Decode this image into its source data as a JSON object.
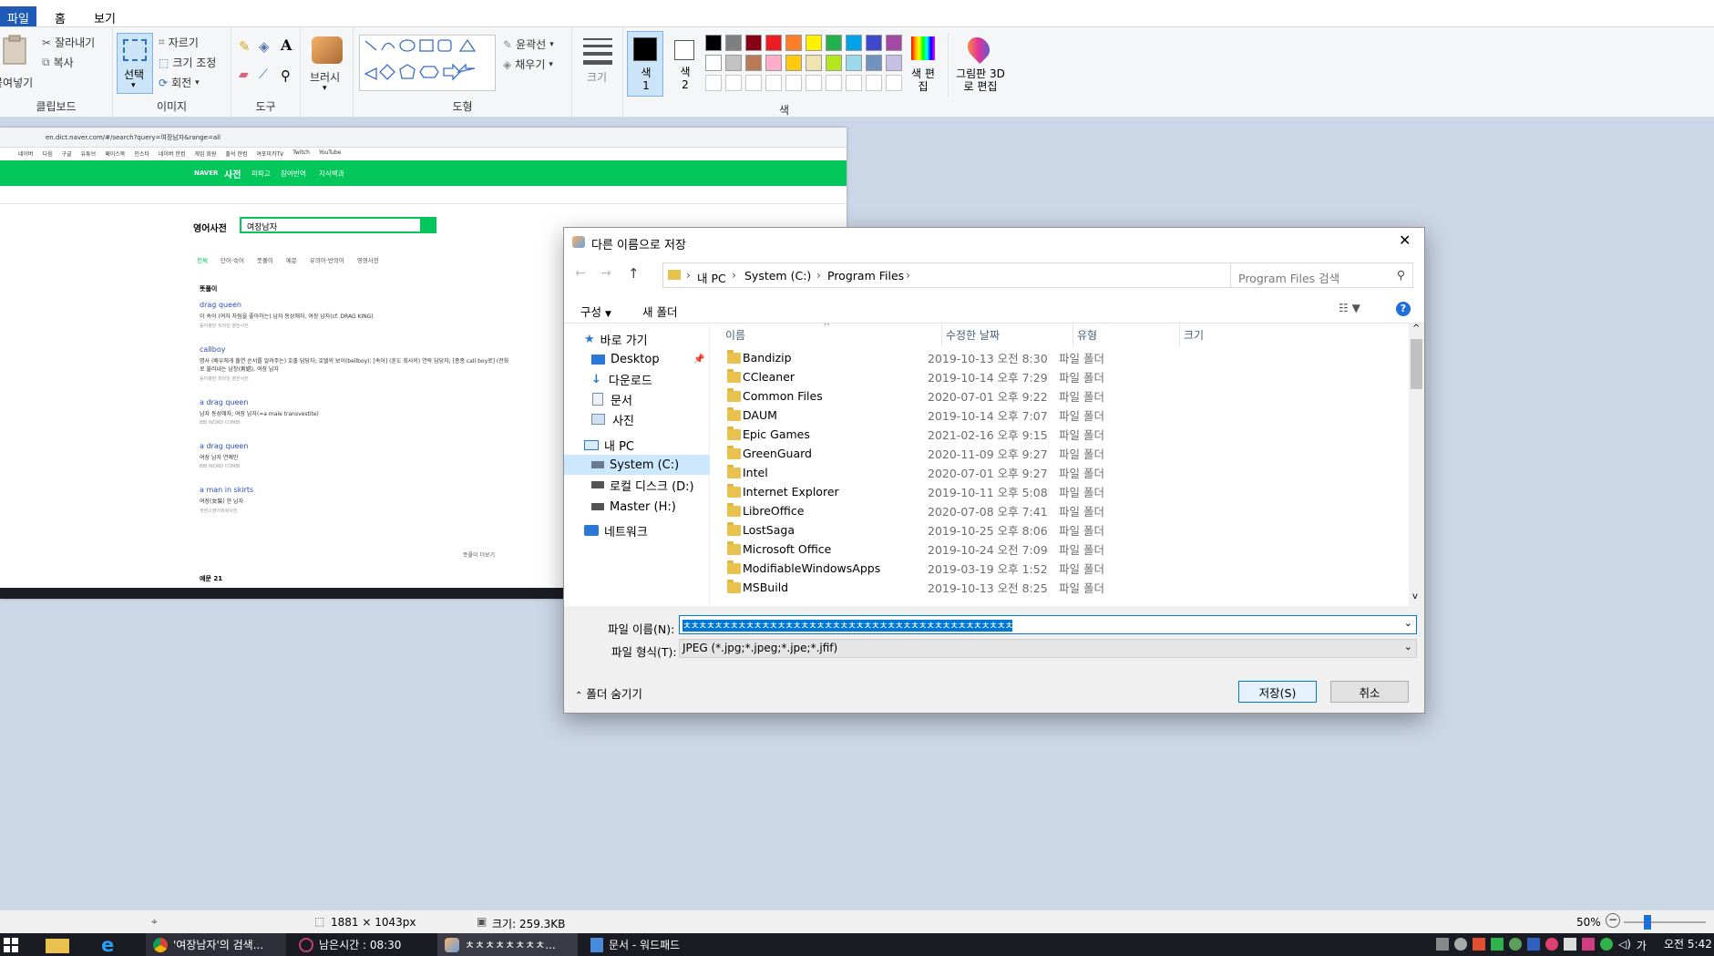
{
  "paint": {
    "tabs": [
      "파일",
      "홈",
      "보기"
    ],
    "clipboard": {
      "paste": "붙여넣기",
      "cut": "잘라내기",
      "copy": "복사",
      "label": "클립보드"
    },
    "image": {
      "select": "선택",
      "crop": "자르기",
      "resize": "크기 조정",
      "rotate": "회전",
      "label": "이미지"
    },
    "tools": {
      "label": "도구"
    },
    "brush": {
      "label": "브러시"
    },
    "shapes": {
      "outline": "윤곽선",
      "fill": "채우기",
      "label": "도형"
    },
    "size": {
      "label": "크기"
    },
    "color1": {
      "label": "색 1"
    },
    "color2": {
      "label": "색 2"
    },
    "colors": {
      "label": "색",
      "edit": "색 편집",
      "row1": [
        "#000000",
        "#7f7f7f",
        "#880015",
        "#ed1c24",
        "#ff7f27",
        "#fff200",
        "#22b14c",
        "#00a2e8",
        "#3f48cc",
        "#a349a4"
      ],
      "row2": [
        "#ffffff",
        "#c3c3c3",
        "#b97a57",
        "#ffaec9",
        "#ffc90e",
        "#efe4b0",
        "#b5e61d",
        "#99d9ea",
        "#7092be",
        "#c8bfe7"
      ]
    },
    "paint3d": "그림판 3D로 편집",
    "status": {
      "dimensions": "1881 × 1043px",
      "filesize": "크기: 259.3KB",
      "zoom": "50%"
    }
  },
  "browser": {
    "url": "en.dict.naver.com/#/search?query=여장남자&range=all",
    "bookmarks": [
      "네이버",
      "다음",
      "구글",
      "유튜브",
      "페이스북",
      "인스타",
      "네이버 한컴",
      "게임 회원",
      "출석 한컴",
      "여포미카TV",
      "Twitch",
      "YouTube"
    ],
    "nav_brand": "NAVER",
    "nav_title": "사전",
    "nav_links": [
      "파파고",
      "참여번역",
      "지식백과"
    ],
    "dict_title": "영어사전",
    "query": "여장남자",
    "tabs": [
      "전체",
      "단어·숙어",
      "뜻풀이",
      "예문",
      "유의어·반의어",
      "영영사전"
    ],
    "section": "뜻풀이",
    "entries": [
      {
        "word": "drag queen",
        "def": "이 속어 (여자 차림을 좋아하는) 남자 동성애자, 여장 남자(cf. DRAG KING)",
        "src": "동아출판 프라임 영한사전"
      },
      {
        "word": "callboy",
        "def": "명사 (배우에게 출연 순서를 알려주는) 호출 담당자; 호텔의 보이(bellboy); [속어] (혼도 회사의) 연락 담당자; [종종 call boy로] (전화로 불러내는 남창(男娼), 여장 남자",
        "src": "동아출판 프라임 영한사전"
      },
      {
        "word": "a drag queen",
        "def": "남자 동성애자; 여장 남자(=a male transvestite)",
        "src": "BBI WORD COMBI"
      },
      {
        "word": "a drag queen",
        "def": "여장 남자 연예인",
        "src": "BBI WORD COMBI"
      },
      {
        "word": "a man in skirts",
        "def": "여장(女裝) 한 남자",
        "src": "엣센스영어회화사전"
      }
    ],
    "more": "뜻풀이 더보기",
    "examples": "예문 21",
    "inner_taskbar": [
      "여장남자'의 검색",
      "남은시간 : 08:30",
      "ㅊㅊㅊㅊㅊㅊ",
      "문서 - 워드패드"
    ]
  },
  "dialog": {
    "title": "다른 이름으로 저장",
    "breadcrumb": [
      "내 PC",
      "System (C:)",
      "Program Files"
    ],
    "search_placeholder": "Program Files 검색",
    "organize": "구성",
    "new_folder": "새 폴더",
    "nav": {
      "quick": "바로 가기",
      "desktop": "Desktop",
      "downloads": "다운로드",
      "documents": "문서",
      "pictures": "사진",
      "thispc": "내 PC",
      "system": "System (C:)",
      "local": "로컬 디스크 (D:)",
      "master": "Master (H:)",
      "network": "네트워크"
    },
    "columns": {
      "name": "이름",
      "date": "수정한 날짜",
      "type": "유형",
      "size": "크기"
    },
    "files": [
      {
        "name": "Bandizip",
        "date": "2019-10-13 오전 8:30",
        "type": "파일 폴더"
      },
      {
        "name": "CCleaner",
        "date": "2019-10-14 오후 7:29",
        "type": "파일 폴더"
      },
      {
        "name": "Common Files",
        "date": "2020-07-01 오후 9:22",
        "type": "파일 폴더"
      },
      {
        "name": "DAUM",
        "date": "2019-10-14 오후 7:07",
        "type": "파일 폴더"
      },
      {
        "name": "Epic Games",
        "date": "2021-02-16 오후 9:15",
        "type": "파일 폴더"
      },
      {
        "name": "GreenGuard",
        "date": "2020-11-09 오후 9:27",
        "type": "파일 폴더"
      },
      {
        "name": "Intel",
        "date": "2020-07-01 오후 9:27",
        "type": "파일 폴더"
      },
      {
        "name": "Internet Explorer",
        "date": "2019-10-11 오후 5:08",
        "type": "파일 폴더"
      },
      {
        "name": "LibreOffice",
        "date": "2020-07-08 오후 7:41",
        "type": "파일 폴더"
      },
      {
        "name": "LostSaga",
        "date": "2019-10-25 오후 8:06",
        "type": "파일 폴더"
      },
      {
        "name": "Microsoft Office",
        "date": "2019-10-24 오전 7:09",
        "type": "파일 폴더"
      },
      {
        "name": "ModifiableWindowsApps",
        "date": "2019-03-19 오후 1:52",
        "type": "파일 폴더"
      },
      {
        "name": "MSBuild",
        "date": "2019-10-13 오전 8:25",
        "type": "파일 폴더"
      }
    ],
    "filename_label": "파일 이름(N):",
    "filename_value": "ㅊㅊㅊㅊㅊㅊㅊㅊㅊㅊㅊㅊㅊㅊㅊㅊㅊㅊㅊㅊㅊㅊㅊㅊㅊㅊㅊㅊㅊㅊㅊㅊㅊㅊㅊㅊㅊㅊㅊㅊㅊㅊ",
    "filetype_label": "파일 형식(T):",
    "filetype_value": "JPEG (*.jpg;*.jpeg;*.jpe;*.jfif)",
    "hide_folders": "폴더 숨기기",
    "save": "저장(S)",
    "cancel": "취소"
  },
  "taskbar": {
    "items": [
      "'여장남자'의 검색...",
      "남은시간 : 08:30",
      "ㅊㅊㅊㅊㅊㅊㅊㅊ...",
      "문서 - 워드패드"
    ],
    "time": "오전 5:42",
    "ime": "가"
  }
}
